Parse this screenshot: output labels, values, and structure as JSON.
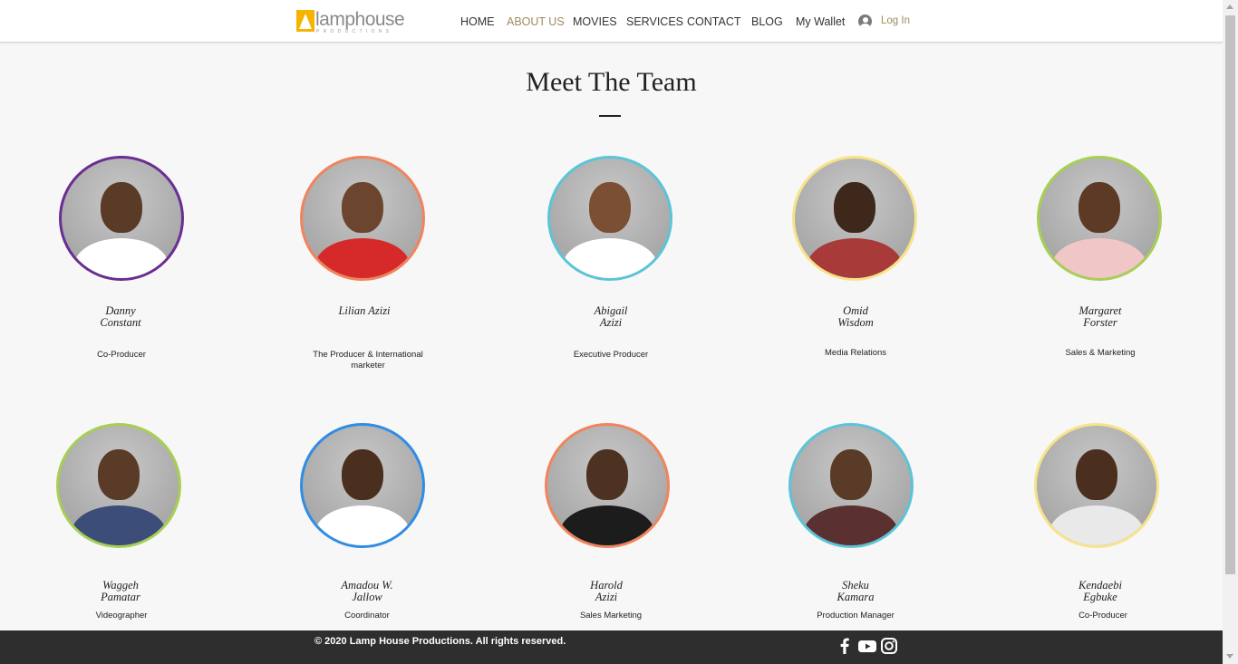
{
  "brand": {
    "name": "lamphouse",
    "tagline": "PRODUCTIONS",
    "logo_color": "#f4b400"
  },
  "nav": {
    "items": [
      {
        "label": "HOME"
      },
      {
        "label": "ABOUT US",
        "active": true
      },
      {
        "label": "MOVIES"
      },
      {
        "label": "SERVICES"
      },
      {
        "label": "CONTACT"
      },
      {
        "label": "BLOG"
      },
      {
        "label": "My Wallet"
      }
    ],
    "login_label": "Log In",
    "login_icon": "user-avatar-icon",
    "active_color": "#a08a60"
  },
  "page": {
    "title": "Meet The Team"
  },
  "team": [
    {
      "name": "Danny\nConstant",
      "role": "Co-Producer",
      "ring_color": "#6a2d91"
    },
    {
      "name": "Lilian Azizi",
      "role": "The Producer & International marketer",
      "ring_color": "#f0845c"
    },
    {
      "name": "Abigail\nAzizi",
      "role": "Executive Producer",
      "ring_color": "#5bc4d8"
    },
    {
      "name": "Omid\nWisdom",
      "role": "Media Relations",
      "ring_color": "#f7e38a"
    },
    {
      "name": "Margaret\nForster",
      "role": "Sales & Marketing",
      "ring_color": "#a7cf53"
    },
    {
      "name": "Waggeh\nPamatar",
      "role": "Videographer",
      "ring_color": "#a7cf53"
    },
    {
      "name": "Amadou W.\nJallow",
      "role": "Coordinator",
      "ring_color": "#2f8de4"
    },
    {
      "name": "Harold\nAzizi",
      "role": "Sales Marketing",
      "ring_color": "#f0845c"
    },
    {
      "name": "Sheku\nKamara",
      "role": "Production Manager",
      "ring_color": "#5bc4d8"
    },
    {
      "name": "Kendaebi\nEgbuke",
      "role": "Co-Producer",
      "ring_color": "#f7e38a"
    }
  ],
  "footer": {
    "copyright": "© 2020 Lamp House Productions. All rights reserved.",
    "social": [
      "facebook-icon",
      "youtube-icon",
      "instagram-icon"
    ]
  }
}
